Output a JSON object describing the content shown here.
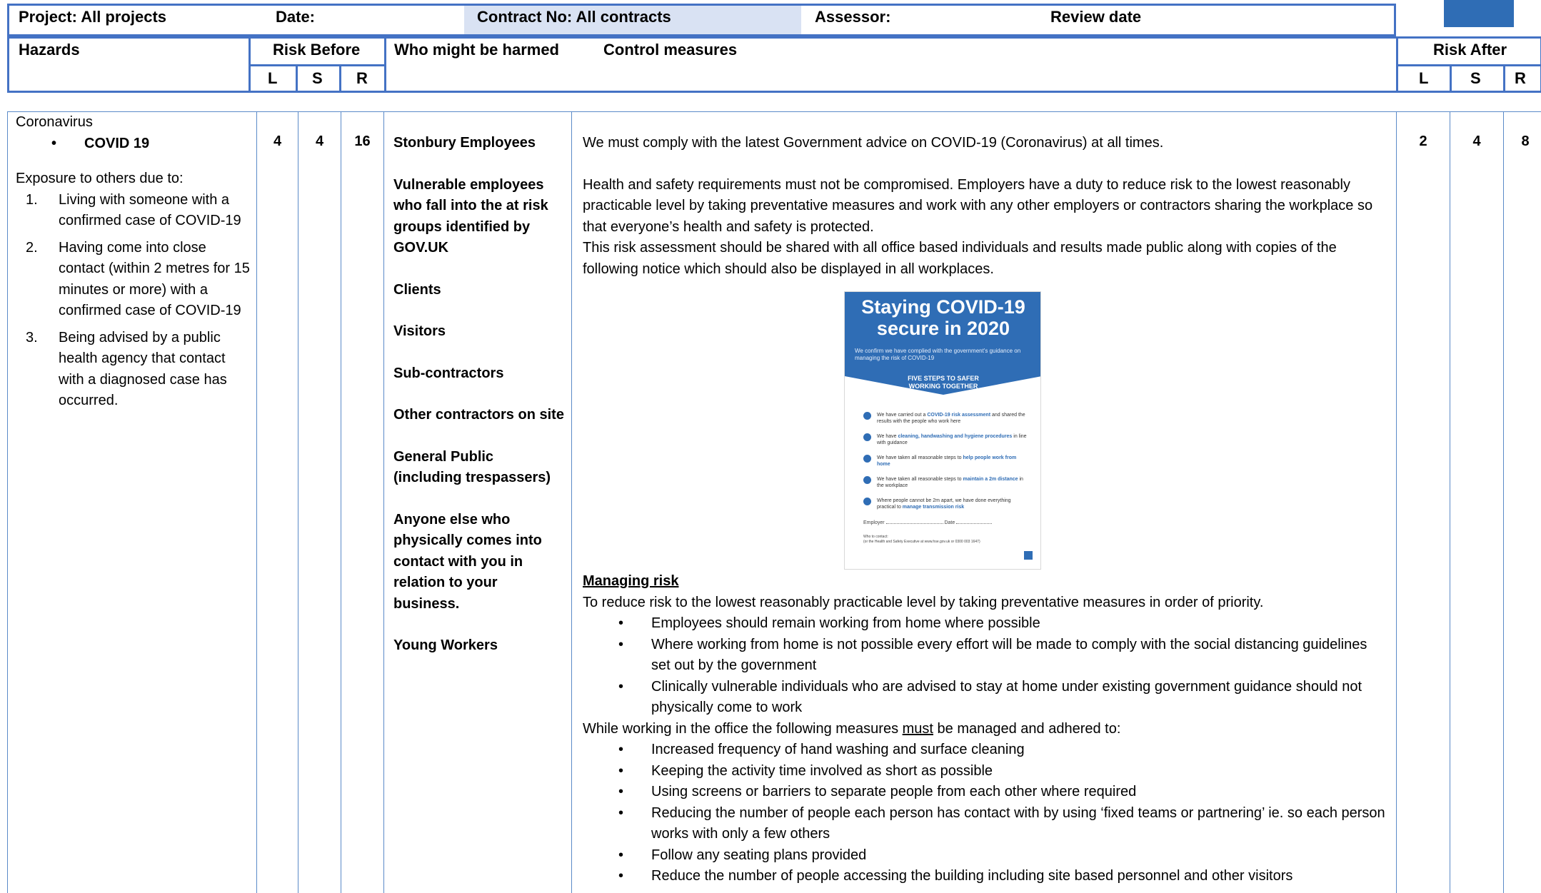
{
  "header": {
    "project": "Project: All projects",
    "date": "Date:",
    "contract": "Contract No:  All contracts",
    "assessor": "Assessor:",
    "review": "Review date"
  },
  "columns": {
    "hazards": "Hazards",
    "risk_before": "Risk Before",
    "who": "Who might be harmed",
    "control": "Control measures",
    "risk_after": "Risk After",
    "l": "L",
    "s": "S",
    "r": "R"
  },
  "row": {
    "hazard_title": "Coronavirus",
    "hazard_bullet": "COVID 19",
    "exposure_intro": "Exposure to others due to:",
    "exposure_items": [
      {
        "n": "1.",
        "text": "Living with someone with a confirmed case of COVID-19"
      },
      {
        "n": "2.",
        "text": "Having come into close contact (within 2 metres for 15 minutes or more) with a confirmed case of COVID-19"
      },
      {
        "n": "3.",
        "text": "Being advised by a public health agency that contact with a diagnosed case has occurred."
      }
    ],
    "risk_before": {
      "l": "4",
      "s": "4",
      "r": "16"
    },
    "risk_after": {
      "l": "2",
      "s": "4",
      "r": "8"
    },
    "who": [
      "Stonbury Employees",
      "Vulnerable employees who fall into the at risk groups identified by GOV.UK",
      "Clients",
      "Visitors",
      "Sub-contractors",
      "Other contractors on site",
      "General Public (including trespassers)",
      "Anyone else who physically comes into contact with you in relation to your business.",
      "Young Workers"
    ],
    "control": {
      "p1": "We must comply with the latest Government advice on COVID-19 (Coronavirus) at all times.",
      "p2": "Health and safety requirements must not be compromised. Employers have a duty to reduce risk to the lowest reasonably practicable level by taking preventative measures and work with any other employers or contractors sharing the workplace so that everyone’s health and safety is protected.",
      "p3": "This risk assessment should be shared with all office based individuals and results made public along with copies of the following notice which should also be displayed in all workplaces.",
      "managing_heading": "Managing risk",
      "p4": "To reduce risk to the lowest reasonably practicable level by taking preventative measures in order of priority.",
      "list1": [
        "Employees should remain working from home where possible",
        "Where working from home is not possible every effort will be made to comply with the social distancing guidelines set out by the government",
        "Clinically vulnerable individuals who are advised to stay at home under existing government guidance should not physically come to work"
      ],
      "p5_a": "While working in the office the following measures ",
      "p5_must": "must",
      "p5_b": " be managed and adhered to:",
      "list2": [
        "Increased frequency of hand washing and surface cleaning",
        "Keeping the activity time involved as short as possible",
        "Using screens or barriers to separate people from each other where required",
        "Reducing the number of people each person has contact with by using ‘fixed teams or partnering’ ie. so each person works with only a few others",
        "Follow any seating plans provided",
        "Reduce the number of people accessing the building including site based personnel and other visitors"
      ]
    }
  },
  "poster": {
    "title_line1": "Staying COVID-19",
    "title_line2": "secure in 2020",
    "subtitle": "We confirm we have complied with the government's guidance on managing the risk of COVID-19",
    "banner": "FIVE STEPS TO SAFER WORKING TOGETHER",
    "steps": [
      {
        "pre": "We have carried out a ",
        "hl": "COVID-19 risk assessment",
        "post": " and shared the results with the people who work here"
      },
      {
        "pre": "We have ",
        "hl": "cleaning, handwashing and hygiene procedures",
        "post": " in line with guidance"
      },
      {
        "pre": "We have taken all reasonable steps to ",
        "hl": "help people work from home",
        "post": ""
      },
      {
        "pre": "We have taken all reasonable steps to ",
        "hl": "maintain a 2m distance",
        "post": " in the workplace"
      },
      {
        "pre": "Where people cannot be 2m apart, we have done everything practical to ",
        "hl": "manage transmission risk",
        "post": ""
      }
    ],
    "employer_label": "Employer",
    "date_label": "Date",
    "who_contact": "Who to contact:",
    "hse_line": "(or the Health and Safety Executive at www.hse.gov.uk or 0300 003 1647)"
  },
  "colors": {
    "accent": "#4472c4",
    "contract_fill": "#d9e2f3",
    "poster_blue": "#2f6db5"
  }
}
